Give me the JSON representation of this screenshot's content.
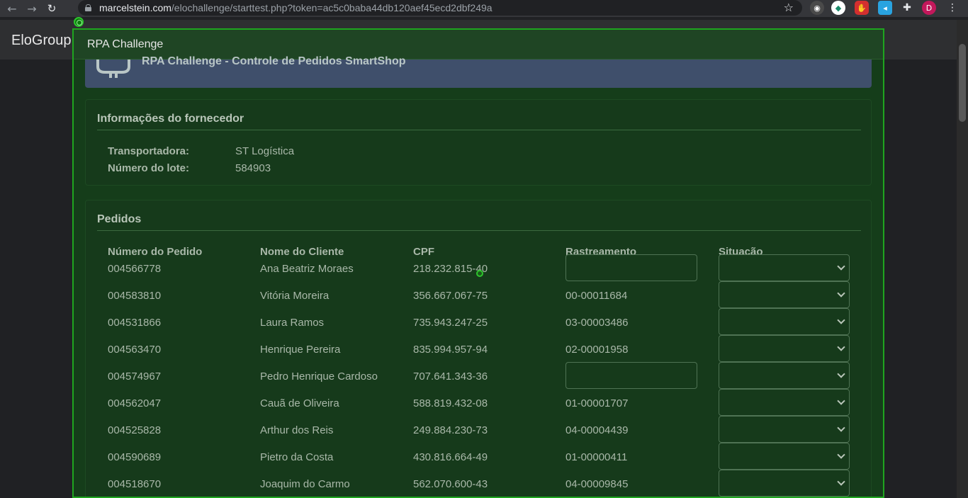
{
  "browser": {
    "url_host": "marcelstein.com",
    "url_path": "/elochallenge/starttest.php?token=ac5c0baba44db120aef45ecd2dbf249a",
    "profile_initial": "D"
  },
  "app": {
    "brand": "EloGroup"
  },
  "overlay": {
    "title": "RPA Challenge"
  },
  "banner": {
    "title": "RPA Challenge - Controle de Pedidos SmartShop"
  },
  "fornecedor": {
    "title": "Informações do fornecedor",
    "transportadora_label": "Transportadora:",
    "transportadora_value": "ST Logística",
    "lote_label": "Número do lote:",
    "lote_value": "584903"
  },
  "pedidos": {
    "title": "Pedidos",
    "headers": [
      "Número do Pedido",
      "Nome do Cliente",
      "CPF",
      "Rastreamento",
      "Situação"
    ],
    "rows": [
      {
        "numero": "004566778",
        "cliente": "Ana Beatriz Moraes",
        "cpf": "218.232.815-40",
        "rastreamento": ""
      },
      {
        "numero": "004583810",
        "cliente": "Vitória Moreira",
        "cpf": "356.667.067-75",
        "rastreamento": "00-00011684"
      },
      {
        "numero": "004531866",
        "cliente": "Laura Ramos",
        "cpf": "735.943.247-25",
        "rastreamento": "03-00003486"
      },
      {
        "numero": "004563470",
        "cliente": "Henrique Pereira",
        "cpf": "835.994.957-94",
        "rastreamento": "02-00001958"
      },
      {
        "numero": "004574967",
        "cliente": "Pedro Henrique Cardoso",
        "cpf": "707.641.343-36",
        "rastreamento": ""
      },
      {
        "numero": "004562047",
        "cliente": "Cauã de Oliveira",
        "cpf": "588.819.432-08",
        "rastreamento": "01-00001707"
      },
      {
        "numero": "004525828",
        "cliente": "Arthur dos Reis",
        "cpf": "249.884.230-73",
        "rastreamento": "04-00004439"
      },
      {
        "numero": "004590689",
        "cliente": "Pietro da Costa",
        "cpf": "430.816.664-49",
        "rastreamento": "01-00000411"
      },
      {
        "numero": "004518670",
        "cliente": "Joaquim do Carmo",
        "cpf": "562.070.600-43",
        "rastreamento": "04-00009845"
      }
    ]
  },
  "icons": {
    "back": "arrow-left-icon",
    "forward": "arrow-right-icon",
    "reload": "reload-icon",
    "lock": "lock-icon",
    "star": "star-icon",
    "extensions": "puzzle-icon",
    "menu": "kebab-menu-icon"
  },
  "colors": {
    "overlay_border": "#1fa51f",
    "overlay_bg": "#153d1a",
    "banner_bg": "#3f4f6b",
    "profile_badge": "#c2185b"
  }
}
